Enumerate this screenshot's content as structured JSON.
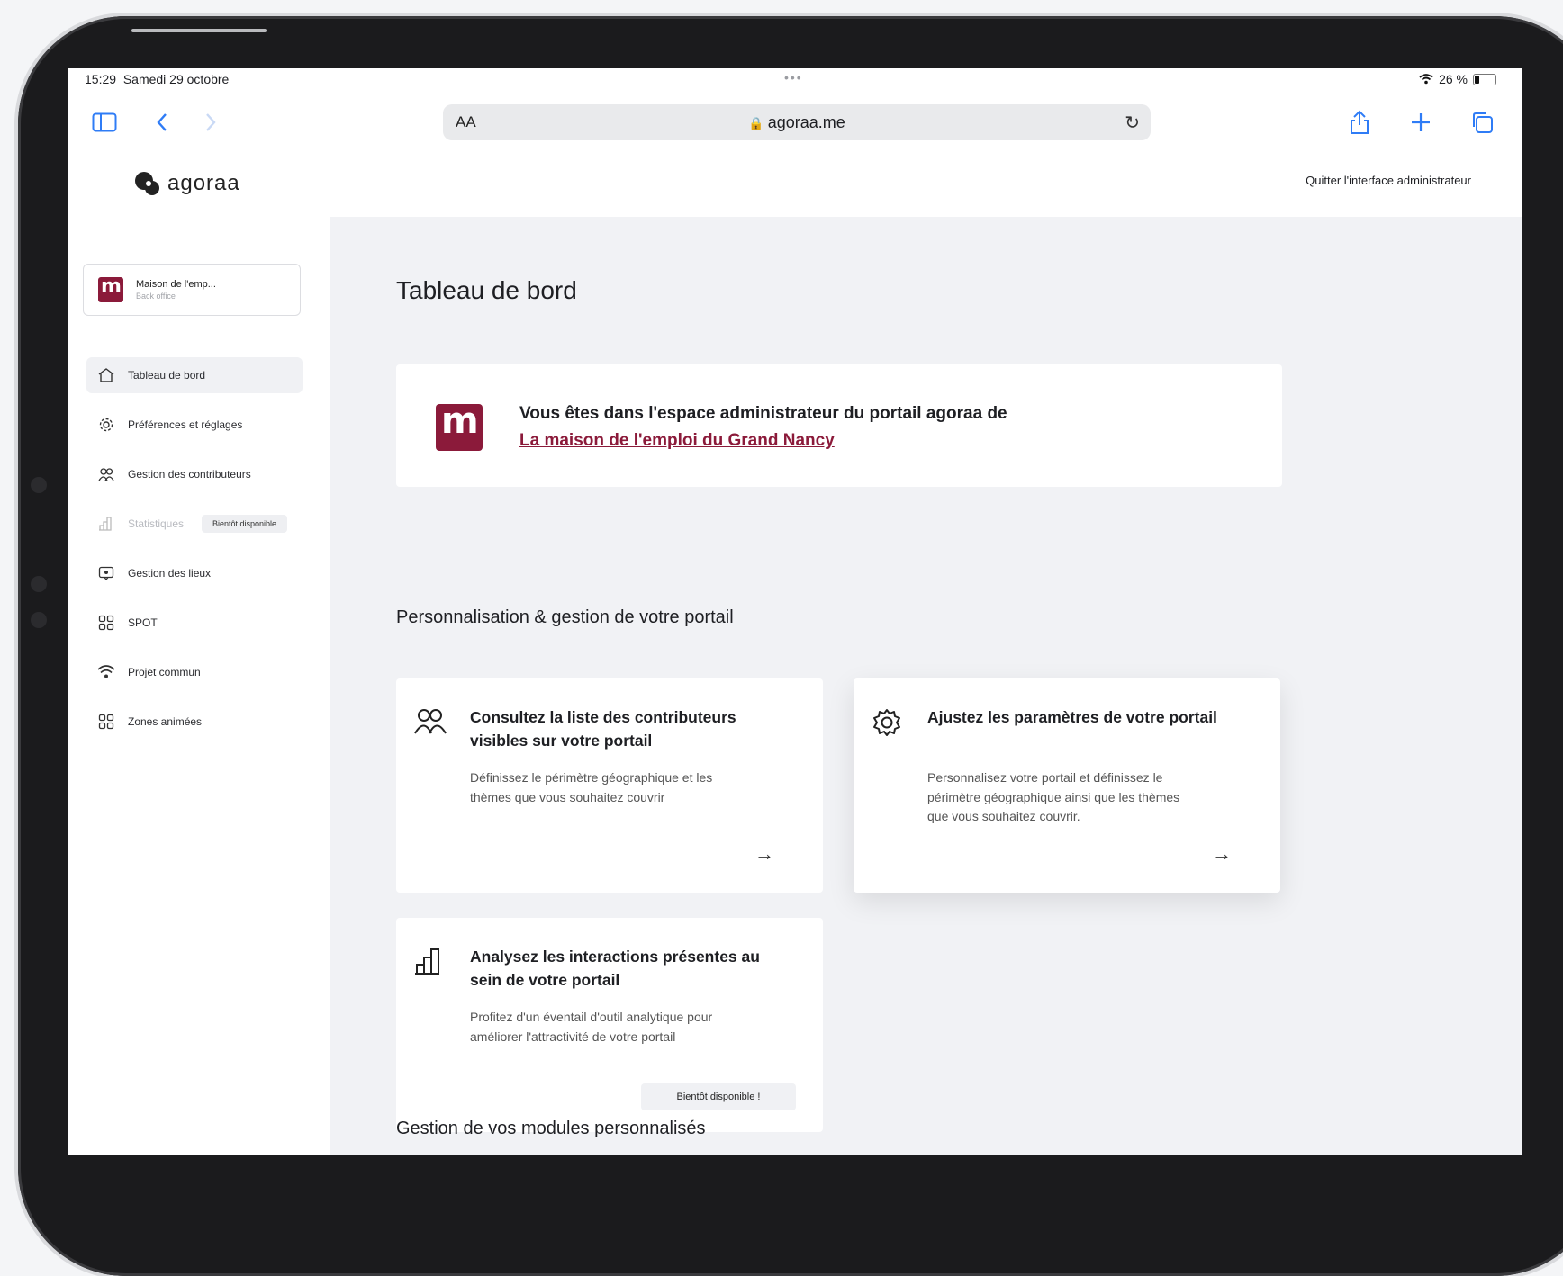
{
  "status_bar": {
    "time": "15:29",
    "date": "Samedi 29 octobre",
    "wifi_icon": "wifi-icon",
    "battery": "26 %"
  },
  "browser": {
    "text_size_label": "AA",
    "url": "agoraa.me"
  },
  "header": {
    "brand": "agoraa",
    "quit_label": "Quitter l'interface administrateur"
  },
  "sidebar": {
    "org_name": "Maison de l'emp...",
    "org_sub": "Back office",
    "items": [
      {
        "label": "Tableau de bord",
        "icon": "home-icon",
        "active": true
      },
      {
        "label": "Préférences et réglages",
        "icon": "gear-icon"
      },
      {
        "label": "Gestion des contributeurs",
        "icon": "users-icon"
      },
      {
        "label": "Statistiques",
        "icon": "chart-icon",
        "disabled": true,
        "badge": "Bientôt disponible"
      },
      {
        "label": "Gestion des lieux",
        "icon": "location-icon"
      },
      {
        "label": "SPOT",
        "icon": "grid-icon"
      },
      {
        "label": "Projet commun",
        "icon": "wifi-icon"
      },
      {
        "label": "Zones animées",
        "icon": "grid-icon"
      }
    ]
  },
  "main": {
    "title": "Tableau de bord",
    "welcome": {
      "line1": "Vous êtes dans l'espace administrateur du portail agoraa de",
      "link": "La maison de l'emploi du Grand Nancy"
    },
    "section1_title": "Personnalisation & gestion de votre portail",
    "cards": [
      {
        "title": "Consultez la liste des contributeurs visibles sur votre portail",
        "desc": "Définissez le périmètre géographique et les thèmes que vous souhaitez couvrir",
        "icon": "users-icon"
      },
      {
        "title": "Ajustez les paramètres de votre portail",
        "desc": "Personnalisez votre portail et définissez le périmètre géographique ainsi que les thèmes que vous souhaitez couvrir.",
        "icon": "gear-icon"
      },
      {
        "title": "Analysez les interactions présentes au sein de votre portail",
        "desc": "Profitez d'un éventail d'outil analytique pour améliorer l'attractivité de votre portail",
        "icon": "chart-icon",
        "chip": "Bientôt disponible !"
      }
    ],
    "section2_title": "Gestion de vos modules personnalisés"
  },
  "colors": {
    "accent": "#8b1a3a",
    "safari_blue": "#2f7cf6",
    "main_bg": "#f1f2f5"
  }
}
